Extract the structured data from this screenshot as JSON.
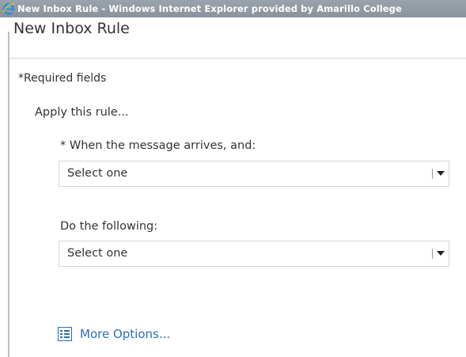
{
  "window": {
    "title": "New Inbox Rule - Windows Internet Explorer provided by Amarillo College"
  },
  "page": {
    "title": "New Inbox Rule",
    "required_note": "*Required fields",
    "apply_label": "Apply this rule..."
  },
  "condition": {
    "label": "* When the message arrives, and:",
    "selected": "Select one"
  },
  "action": {
    "label": "Do the following:",
    "selected": "Select one"
  },
  "more_options": {
    "label": "More Options...",
    "icon": "list-icon"
  },
  "colors": {
    "titlebar": "#8e979f",
    "link": "#2a6ebb",
    "text": "#333333"
  }
}
